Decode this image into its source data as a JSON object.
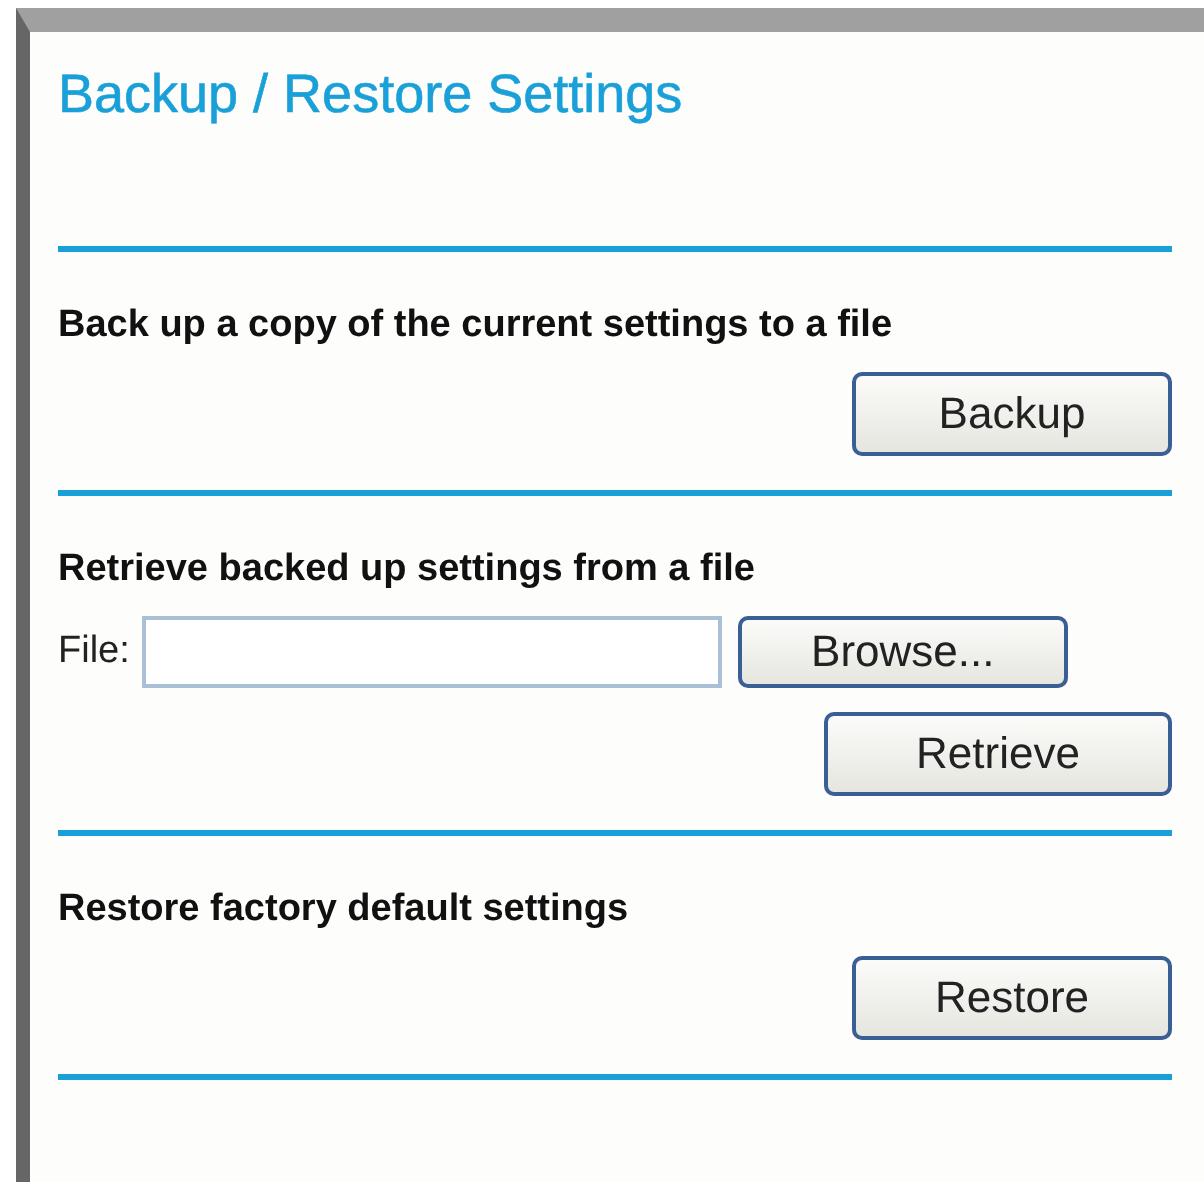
{
  "title": "Backup / Restore Settings",
  "sections": [
    {
      "kind": "plain",
      "heading": "Back up a copy of the current settings to a file",
      "button": "Backup"
    },
    {
      "kind": "file",
      "heading": "Retrieve backed up settings from a file",
      "file_label": "File:",
      "browse_button": "Browse...",
      "button": "Retrieve"
    },
    {
      "kind": "plain",
      "heading": "Restore factory default settings",
      "button": "Restore"
    }
  ]
}
